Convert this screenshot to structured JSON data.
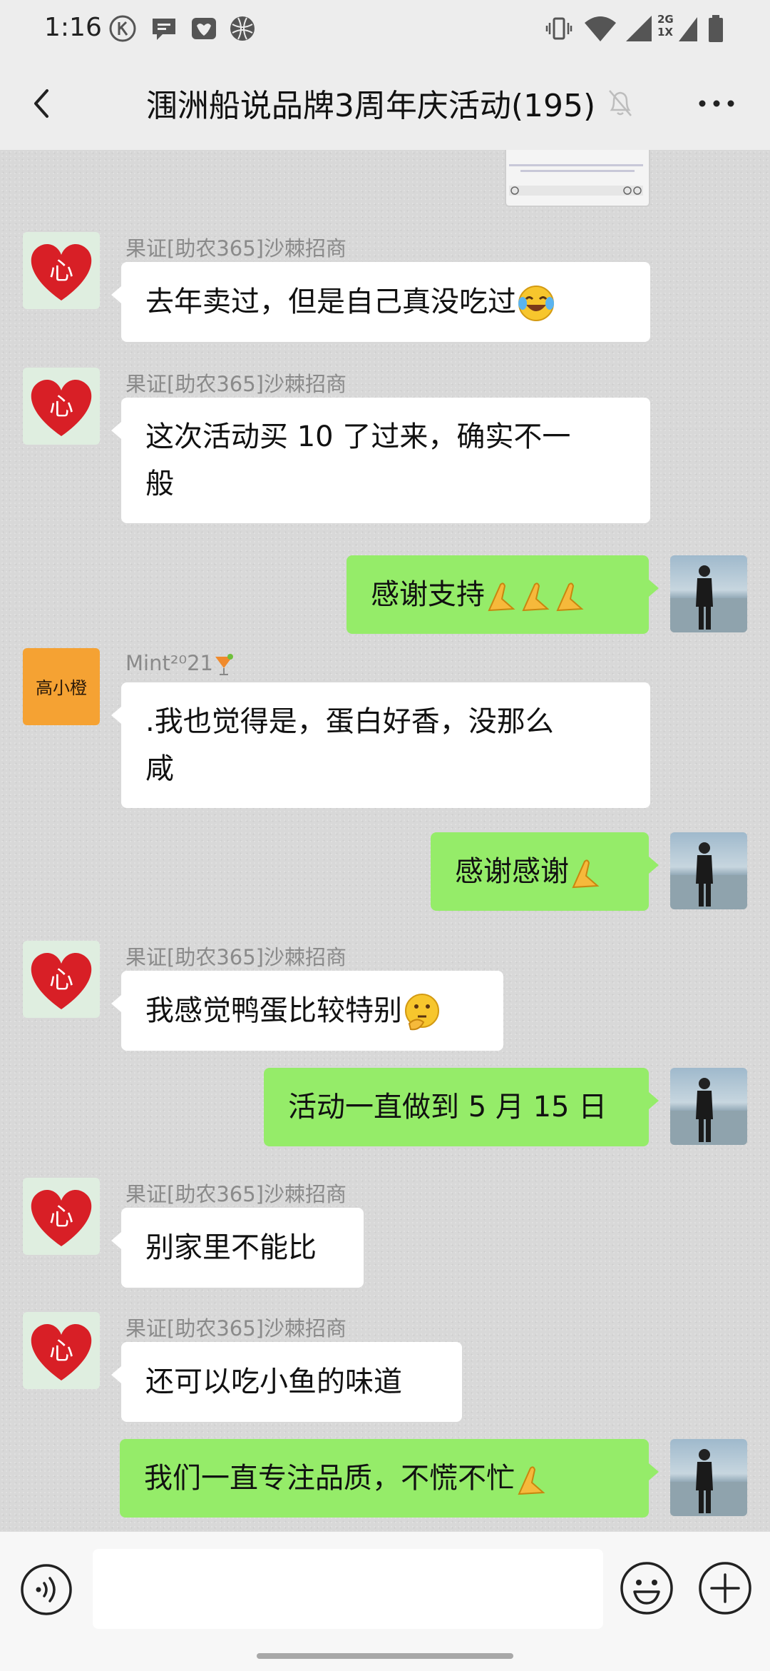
{
  "status_bar": {
    "time": "1:16",
    "network_label_top": "2G",
    "network_label_bottom": "1X"
  },
  "header": {
    "title": "涠洲船说品牌3周年庆活动(195)",
    "back_icon": "chevron-left-icon",
    "mute_icon": "bell-muted-icon",
    "more_icon": "more-dots-icon"
  },
  "messages": [
    {
      "side": "in",
      "sender": "果证[助农365]沙棘招商",
      "text": "去年卖过，但是自己真没吃过",
      "emoji": "laugh-cry-emoji"
    },
    {
      "side": "in",
      "sender": "果证[助农365]沙棘招商",
      "lines": [
        "这次活动买 10 了过来，确实不一",
        "般"
      ]
    },
    {
      "side": "out",
      "text": "感谢支持",
      "emoji": "pray-x3"
    },
    {
      "side": "in",
      "sender": "Mint²⁰21",
      "avatar_text": "高小橙",
      "lines": [
        ".我也觉得是，蛋白好香，没那么",
        "咸"
      ]
    },
    {
      "side": "out",
      "text": "感谢感谢",
      "emoji": "pray"
    },
    {
      "side": "in",
      "sender": "果证[助农365]沙棘招商",
      "text": "我感觉鸭蛋比较特别",
      "emoji": "thinking-emoji"
    },
    {
      "side": "out",
      "text": "活动一直做到 5 月 15 日"
    },
    {
      "side": "in",
      "sender": "果证[助农365]沙棘招商",
      "text": "别家里不能比"
    },
    {
      "side": "in",
      "sender": "果证[助农365]沙棘招商",
      "text": "还可以吃小鱼的味道"
    },
    {
      "side": "out",
      "text": "我们一直专注品质，不慌不忙",
      "emoji": "pray"
    }
  ],
  "heart_avatar_char": "心",
  "input": {
    "value": "",
    "voice_icon": "voice-icon",
    "emoji_icon": "emoji-smile-icon",
    "plus_icon": "plus-circle-icon"
  },
  "colors": {
    "out_bubble": "#95ec69",
    "in_bubble": "#ffffff",
    "header_bg": "#ededed"
  }
}
